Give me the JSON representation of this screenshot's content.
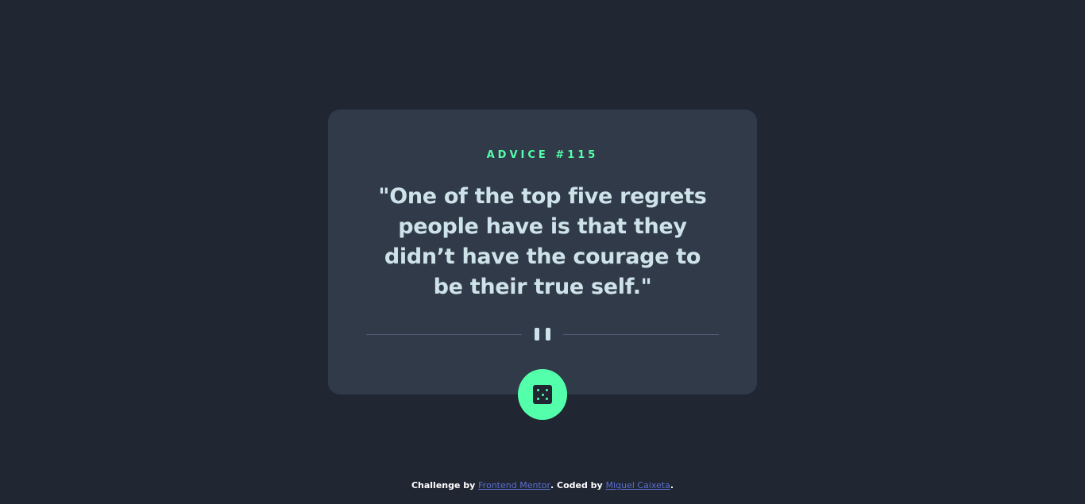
{
  "card": {
    "advice_label": "ADVICE #115",
    "quote": "\"One of the top five regrets people have is that they didn’t have the courage to be their true self.\""
  },
  "divider": {
    "icon": "pause-icon"
  },
  "dice_button": {
    "icon": "dice-icon"
  },
  "footer": {
    "prefix": "Challenge by ",
    "link1_label": "Frontend Mentor",
    "middle": ". Coded by ",
    "link2_label": "Miguel Caixeta",
    "suffix": "."
  },
  "colors": {
    "background": "#202632",
    "card": "#313a48",
    "accent": "#53ffaa",
    "quote_text": "#cee3e9",
    "divider": "#4f5d74",
    "link": "#5a6fd1"
  }
}
